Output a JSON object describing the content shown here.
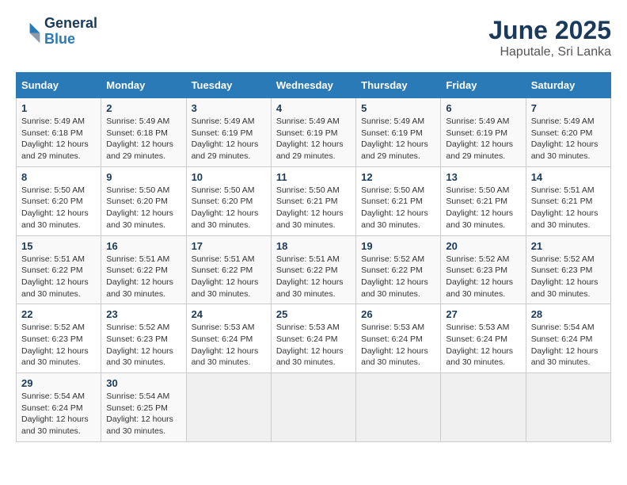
{
  "logo": {
    "line1": "General",
    "line2": "Blue"
  },
  "title": "June 2025",
  "subtitle": "Haputale, Sri Lanka",
  "days_of_week": [
    "Sunday",
    "Monday",
    "Tuesday",
    "Wednesday",
    "Thursday",
    "Friday",
    "Saturday"
  ],
  "weeks": [
    [
      {
        "day": "1",
        "sunrise": "Sunrise: 5:49 AM",
        "sunset": "Sunset: 6:18 PM",
        "daylight": "Daylight: 12 hours and 29 minutes."
      },
      {
        "day": "2",
        "sunrise": "Sunrise: 5:49 AM",
        "sunset": "Sunset: 6:18 PM",
        "daylight": "Daylight: 12 hours and 29 minutes."
      },
      {
        "day": "3",
        "sunrise": "Sunrise: 5:49 AM",
        "sunset": "Sunset: 6:19 PM",
        "daylight": "Daylight: 12 hours and 29 minutes."
      },
      {
        "day": "4",
        "sunrise": "Sunrise: 5:49 AM",
        "sunset": "Sunset: 6:19 PM",
        "daylight": "Daylight: 12 hours and 29 minutes."
      },
      {
        "day": "5",
        "sunrise": "Sunrise: 5:49 AM",
        "sunset": "Sunset: 6:19 PM",
        "daylight": "Daylight: 12 hours and 29 minutes."
      },
      {
        "day": "6",
        "sunrise": "Sunrise: 5:49 AM",
        "sunset": "Sunset: 6:19 PM",
        "daylight": "Daylight: 12 hours and 29 minutes."
      },
      {
        "day": "7",
        "sunrise": "Sunrise: 5:49 AM",
        "sunset": "Sunset: 6:20 PM",
        "daylight": "Daylight: 12 hours and 30 minutes."
      }
    ],
    [
      {
        "day": "8",
        "sunrise": "Sunrise: 5:50 AM",
        "sunset": "Sunset: 6:20 PM",
        "daylight": "Daylight: 12 hours and 30 minutes."
      },
      {
        "day": "9",
        "sunrise": "Sunrise: 5:50 AM",
        "sunset": "Sunset: 6:20 PM",
        "daylight": "Daylight: 12 hours and 30 minutes."
      },
      {
        "day": "10",
        "sunrise": "Sunrise: 5:50 AM",
        "sunset": "Sunset: 6:20 PM",
        "daylight": "Daylight: 12 hours and 30 minutes."
      },
      {
        "day": "11",
        "sunrise": "Sunrise: 5:50 AM",
        "sunset": "Sunset: 6:21 PM",
        "daylight": "Daylight: 12 hours and 30 minutes."
      },
      {
        "day": "12",
        "sunrise": "Sunrise: 5:50 AM",
        "sunset": "Sunset: 6:21 PM",
        "daylight": "Daylight: 12 hours and 30 minutes."
      },
      {
        "day": "13",
        "sunrise": "Sunrise: 5:50 AM",
        "sunset": "Sunset: 6:21 PM",
        "daylight": "Daylight: 12 hours and 30 minutes."
      },
      {
        "day": "14",
        "sunrise": "Sunrise: 5:51 AM",
        "sunset": "Sunset: 6:21 PM",
        "daylight": "Daylight: 12 hours and 30 minutes."
      }
    ],
    [
      {
        "day": "15",
        "sunrise": "Sunrise: 5:51 AM",
        "sunset": "Sunset: 6:22 PM",
        "daylight": "Daylight: 12 hours and 30 minutes."
      },
      {
        "day": "16",
        "sunrise": "Sunrise: 5:51 AM",
        "sunset": "Sunset: 6:22 PM",
        "daylight": "Daylight: 12 hours and 30 minutes."
      },
      {
        "day": "17",
        "sunrise": "Sunrise: 5:51 AM",
        "sunset": "Sunset: 6:22 PM",
        "daylight": "Daylight: 12 hours and 30 minutes."
      },
      {
        "day": "18",
        "sunrise": "Sunrise: 5:51 AM",
        "sunset": "Sunset: 6:22 PM",
        "daylight": "Daylight: 12 hours and 30 minutes."
      },
      {
        "day": "19",
        "sunrise": "Sunrise: 5:52 AM",
        "sunset": "Sunset: 6:22 PM",
        "daylight": "Daylight: 12 hours and 30 minutes."
      },
      {
        "day": "20",
        "sunrise": "Sunrise: 5:52 AM",
        "sunset": "Sunset: 6:23 PM",
        "daylight": "Daylight: 12 hours and 30 minutes."
      },
      {
        "day": "21",
        "sunrise": "Sunrise: 5:52 AM",
        "sunset": "Sunset: 6:23 PM",
        "daylight": "Daylight: 12 hours and 30 minutes."
      }
    ],
    [
      {
        "day": "22",
        "sunrise": "Sunrise: 5:52 AM",
        "sunset": "Sunset: 6:23 PM",
        "daylight": "Daylight: 12 hours and 30 minutes."
      },
      {
        "day": "23",
        "sunrise": "Sunrise: 5:52 AM",
        "sunset": "Sunset: 6:23 PM",
        "daylight": "Daylight: 12 hours and 30 minutes."
      },
      {
        "day": "24",
        "sunrise": "Sunrise: 5:53 AM",
        "sunset": "Sunset: 6:24 PM",
        "daylight": "Daylight: 12 hours and 30 minutes."
      },
      {
        "day": "25",
        "sunrise": "Sunrise: 5:53 AM",
        "sunset": "Sunset: 6:24 PM",
        "daylight": "Daylight: 12 hours and 30 minutes."
      },
      {
        "day": "26",
        "sunrise": "Sunrise: 5:53 AM",
        "sunset": "Sunset: 6:24 PM",
        "daylight": "Daylight: 12 hours and 30 minutes."
      },
      {
        "day": "27",
        "sunrise": "Sunrise: 5:53 AM",
        "sunset": "Sunset: 6:24 PM",
        "daylight": "Daylight: 12 hours and 30 minutes."
      },
      {
        "day": "28",
        "sunrise": "Sunrise: 5:54 AM",
        "sunset": "Sunset: 6:24 PM",
        "daylight": "Daylight: 12 hours and 30 minutes."
      }
    ],
    [
      {
        "day": "29",
        "sunrise": "Sunrise: 5:54 AM",
        "sunset": "Sunset: 6:24 PM",
        "daylight": "Daylight: 12 hours and 30 minutes."
      },
      {
        "day": "30",
        "sunrise": "Sunrise: 5:54 AM",
        "sunset": "Sunset: 6:25 PM",
        "daylight": "Daylight: 12 hours and 30 minutes."
      },
      null,
      null,
      null,
      null,
      null
    ]
  ]
}
